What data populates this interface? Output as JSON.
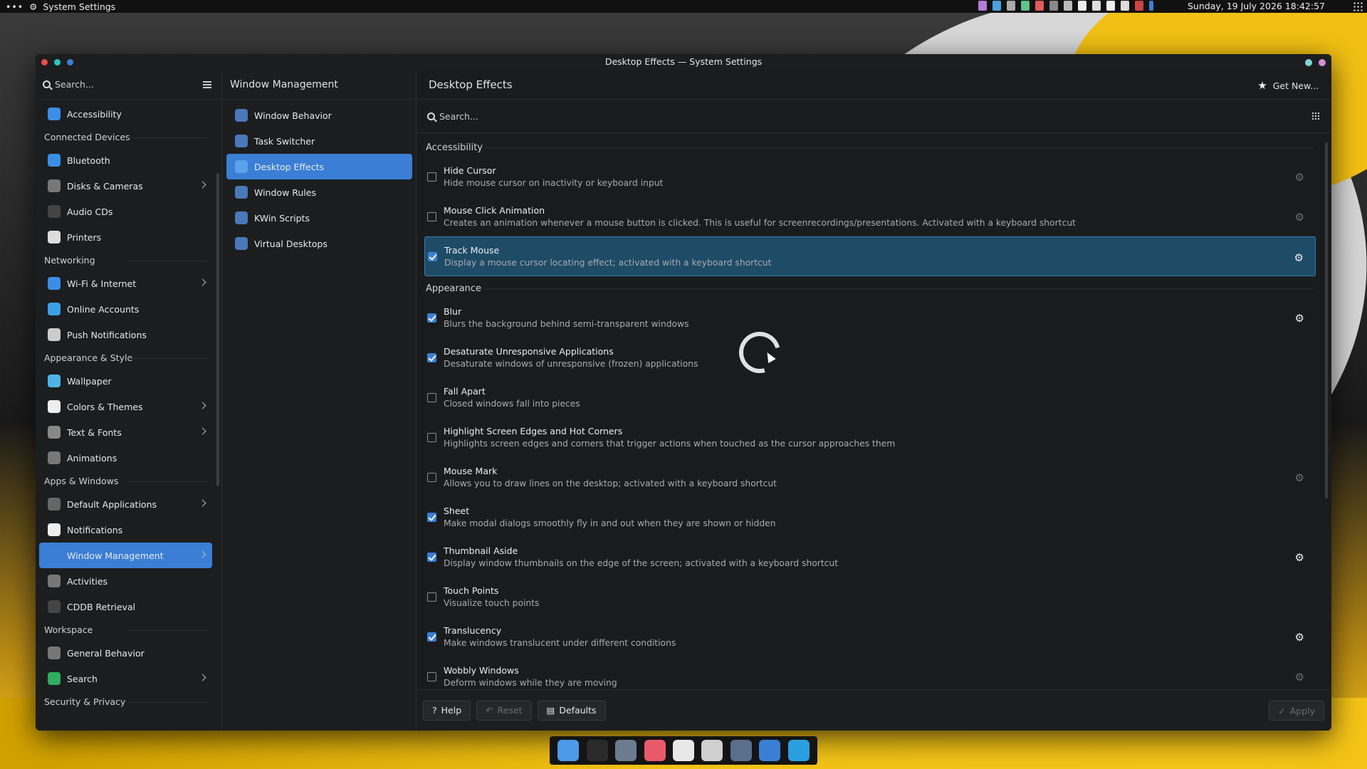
{
  "panel": {
    "app_title": "System Settings",
    "clock": "Sunday, 19 July 2026 18:42:57"
  },
  "window": {
    "title": "Desktop Effects — System Settings"
  },
  "sidebar": {
    "search_placeholder": "Search...",
    "entries": [
      {
        "kind": "item",
        "label": "Accessibility",
        "icon": "accessibility-icon",
        "color": "#3a8ee6"
      },
      {
        "kind": "section",
        "label": "Connected Devices"
      },
      {
        "kind": "item",
        "label": "Bluetooth",
        "icon": "bluetooth-icon",
        "color": "#3a8ee6"
      },
      {
        "kind": "item",
        "label": "Disks & Cameras",
        "icon": "disks-icon",
        "color": "#777",
        "chev": true
      },
      {
        "kind": "item",
        "label": "Audio CDs",
        "icon": "audio-cd-icon",
        "color": "#444"
      },
      {
        "kind": "item",
        "label": "Printers",
        "icon": "printer-icon",
        "color": "#ddd"
      },
      {
        "kind": "section",
        "label": "Networking"
      },
      {
        "kind": "item",
        "label": "Wi-Fi & Internet",
        "icon": "wifi-icon",
        "color": "#3a8ee6",
        "chev": true
      },
      {
        "kind": "item",
        "label": "Online Accounts",
        "icon": "cloud-icon",
        "color": "#3aa0e6"
      },
      {
        "kind": "item",
        "label": "Push Notifications",
        "icon": "network-icon",
        "color": "#ccc"
      },
      {
        "kind": "section",
        "label": "Appearance & Style"
      },
      {
        "kind": "item",
        "label": "Wallpaper",
        "icon": "wallpaper-icon",
        "color": "#4fb3e8"
      },
      {
        "kind": "item",
        "label": "Colors & Themes",
        "icon": "themes-icon",
        "color": "#eee",
        "chev": true
      },
      {
        "kind": "item",
        "label": "Text & Fonts",
        "icon": "fonts-icon",
        "color": "#888",
        "chev": true
      },
      {
        "kind": "item",
        "label": "Animations",
        "icon": "animations-icon",
        "color": "#777"
      },
      {
        "kind": "section",
        "label": "Apps & Windows"
      },
      {
        "kind": "item",
        "label": "Default Applications",
        "icon": "default-apps-icon",
        "color": "#666",
        "chev": true
      },
      {
        "kind": "item",
        "label": "Notifications",
        "icon": "notifications-icon",
        "color": "#eee"
      },
      {
        "kind": "item",
        "label": "Window Management",
        "icon": "window-management-icon",
        "color": "#3a7fd5",
        "chev": true,
        "selected": true
      },
      {
        "kind": "item",
        "label": "Activities",
        "icon": "activities-icon",
        "color": "#777"
      },
      {
        "kind": "item",
        "label": "CDDB Retrieval",
        "icon": "cddb-icon",
        "color": "#444"
      },
      {
        "kind": "section",
        "label": "Workspace"
      },
      {
        "kind": "item",
        "label": "General Behavior",
        "icon": "general-behavior-icon",
        "color": "#777"
      },
      {
        "kind": "item",
        "label": "Search",
        "icon": "search-settings-icon",
        "color": "#2eae5e",
        "chev": true
      },
      {
        "kind": "section",
        "label": "Security & Privacy"
      }
    ]
  },
  "subnav": {
    "title": "Window Management",
    "items": [
      {
        "label": "Window Behavior",
        "icon": "window-behavior-icon"
      },
      {
        "label": "Task Switcher",
        "icon": "task-switcher-icon"
      },
      {
        "label": "Desktop Effects",
        "icon": "desktop-effects-icon",
        "selected": true
      },
      {
        "label": "Window Rules",
        "icon": "window-rules-icon"
      },
      {
        "label": "KWin Scripts",
        "icon": "kwin-scripts-icon"
      },
      {
        "label": "Virtual Desktops",
        "icon": "virtual-desktops-icon"
      }
    ]
  },
  "main": {
    "title": "Desktop Effects",
    "get_new": "Get New...",
    "search_placeholder": "Search...",
    "groups": [
      {
        "name": "Accessibility",
        "effects": [
          {
            "name": "Hide Cursor",
            "desc": "Hide mouse cursor on inactivity or keyboard input",
            "checked": false,
            "gear": "dim"
          },
          {
            "name": "Mouse Click Animation",
            "desc": "Creates an animation whenever a mouse button is clicked. This is useful for screenrecordings/presentations. Activated with a keyboard shortcut",
            "checked": false,
            "gear": "dim"
          },
          {
            "name": "Track Mouse",
            "desc": "Display a mouse cursor locating effect; activated with a keyboard shortcut",
            "checked": true,
            "gear": "on",
            "highlighted": true
          }
        ]
      },
      {
        "name": "Appearance",
        "effects": [
          {
            "name": "Blur",
            "desc": "Blurs the background behind semi-transparent windows",
            "checked": true,
            "gear": "on"
          },
          {
            "name": "Desaturate Unresponsive Applications",
            "desc": "Desaturate windows of unresponsive (frozen) applications",
            "checked": true,
            "gear": "none"
          },
          {
            "name": "Fall Apart",
            "desc": "Closed windows fall into pieces",
            "checked": false,
            "gear": "none"
          },
          {
            "name": "Highlight Screen Edges and Hot Corners",
            "desc": "Highlights screen edges and corners that trigger actions when touched as the cursor approaches them",
            "checked": false,
            "gear": "none"
          },
          {
            "name": "Mouse Mark",
            "desc": "Allows you to draw lines on the desktop; activated with a keyboard shortcut",
            "checked": false,
            "gear": "dim"
          },
          {
            "name": "Sheet",
            "desc": "Make modal dialogs smoothly fly in and out when they are shown or hidden",
            "checked": true,
            "gear": "none"
          },
          {
            "name": "Thumbnail Aside",
            "desc": "Display window thumbnails on the edge of the screen; activated with a keyboard shortcut",
            "checked": true,
            "gear": "on"
          },
          {
            "name": "Touch Points",
            "desc": "Visualize touch points",
            "checked": false,
            "gear": "none"
          },
          {
            "name": "Translucency",
            "desc": "Make windows translucent under different conditions",
            "checked": true,
            "gear": "on"
          },
          {
            "name": "Wobbly Windows",
            "desc": "Deform windows while they are moving",
            "checked": false,
            "gear": "dim"
          }
        ]
      }
    ]
  },
  "footer": {
    "help": "Help",
    "reset": "Reset",
    "defaults": "Defaults",
    "apply": "Apply"
  },
  "dock": {
    "items": [
      {
        "icon": "finder-icon",
        "color": "#4b9be8"
      },
      {
        "icon": "terminal-icon",
        "color": "#2a2a2a"
      },
      {
        "icon": "file-manager-icon",
        "color": "#6c7b8e"
      },
      {
        "icon": "photos-icon",
        "color": "#e85a6a"
      },
      {
        "icon": "text-editor-icon",
        "color": "#e8e8e8"
      },
      {
        "icon": "calculator-icon",
        "color": "#cfcfcf"
      },
      {
        "icon": "system-settings-icon",
        "color": "#5a6f8a"
      },
      {
        "icon": "browser-icon",
        "color": "#3a7fd5"
      },
      {
        "icon": "telegram-icon",
        "color": "#2a9fe0"
      }
    ]
  }
}
